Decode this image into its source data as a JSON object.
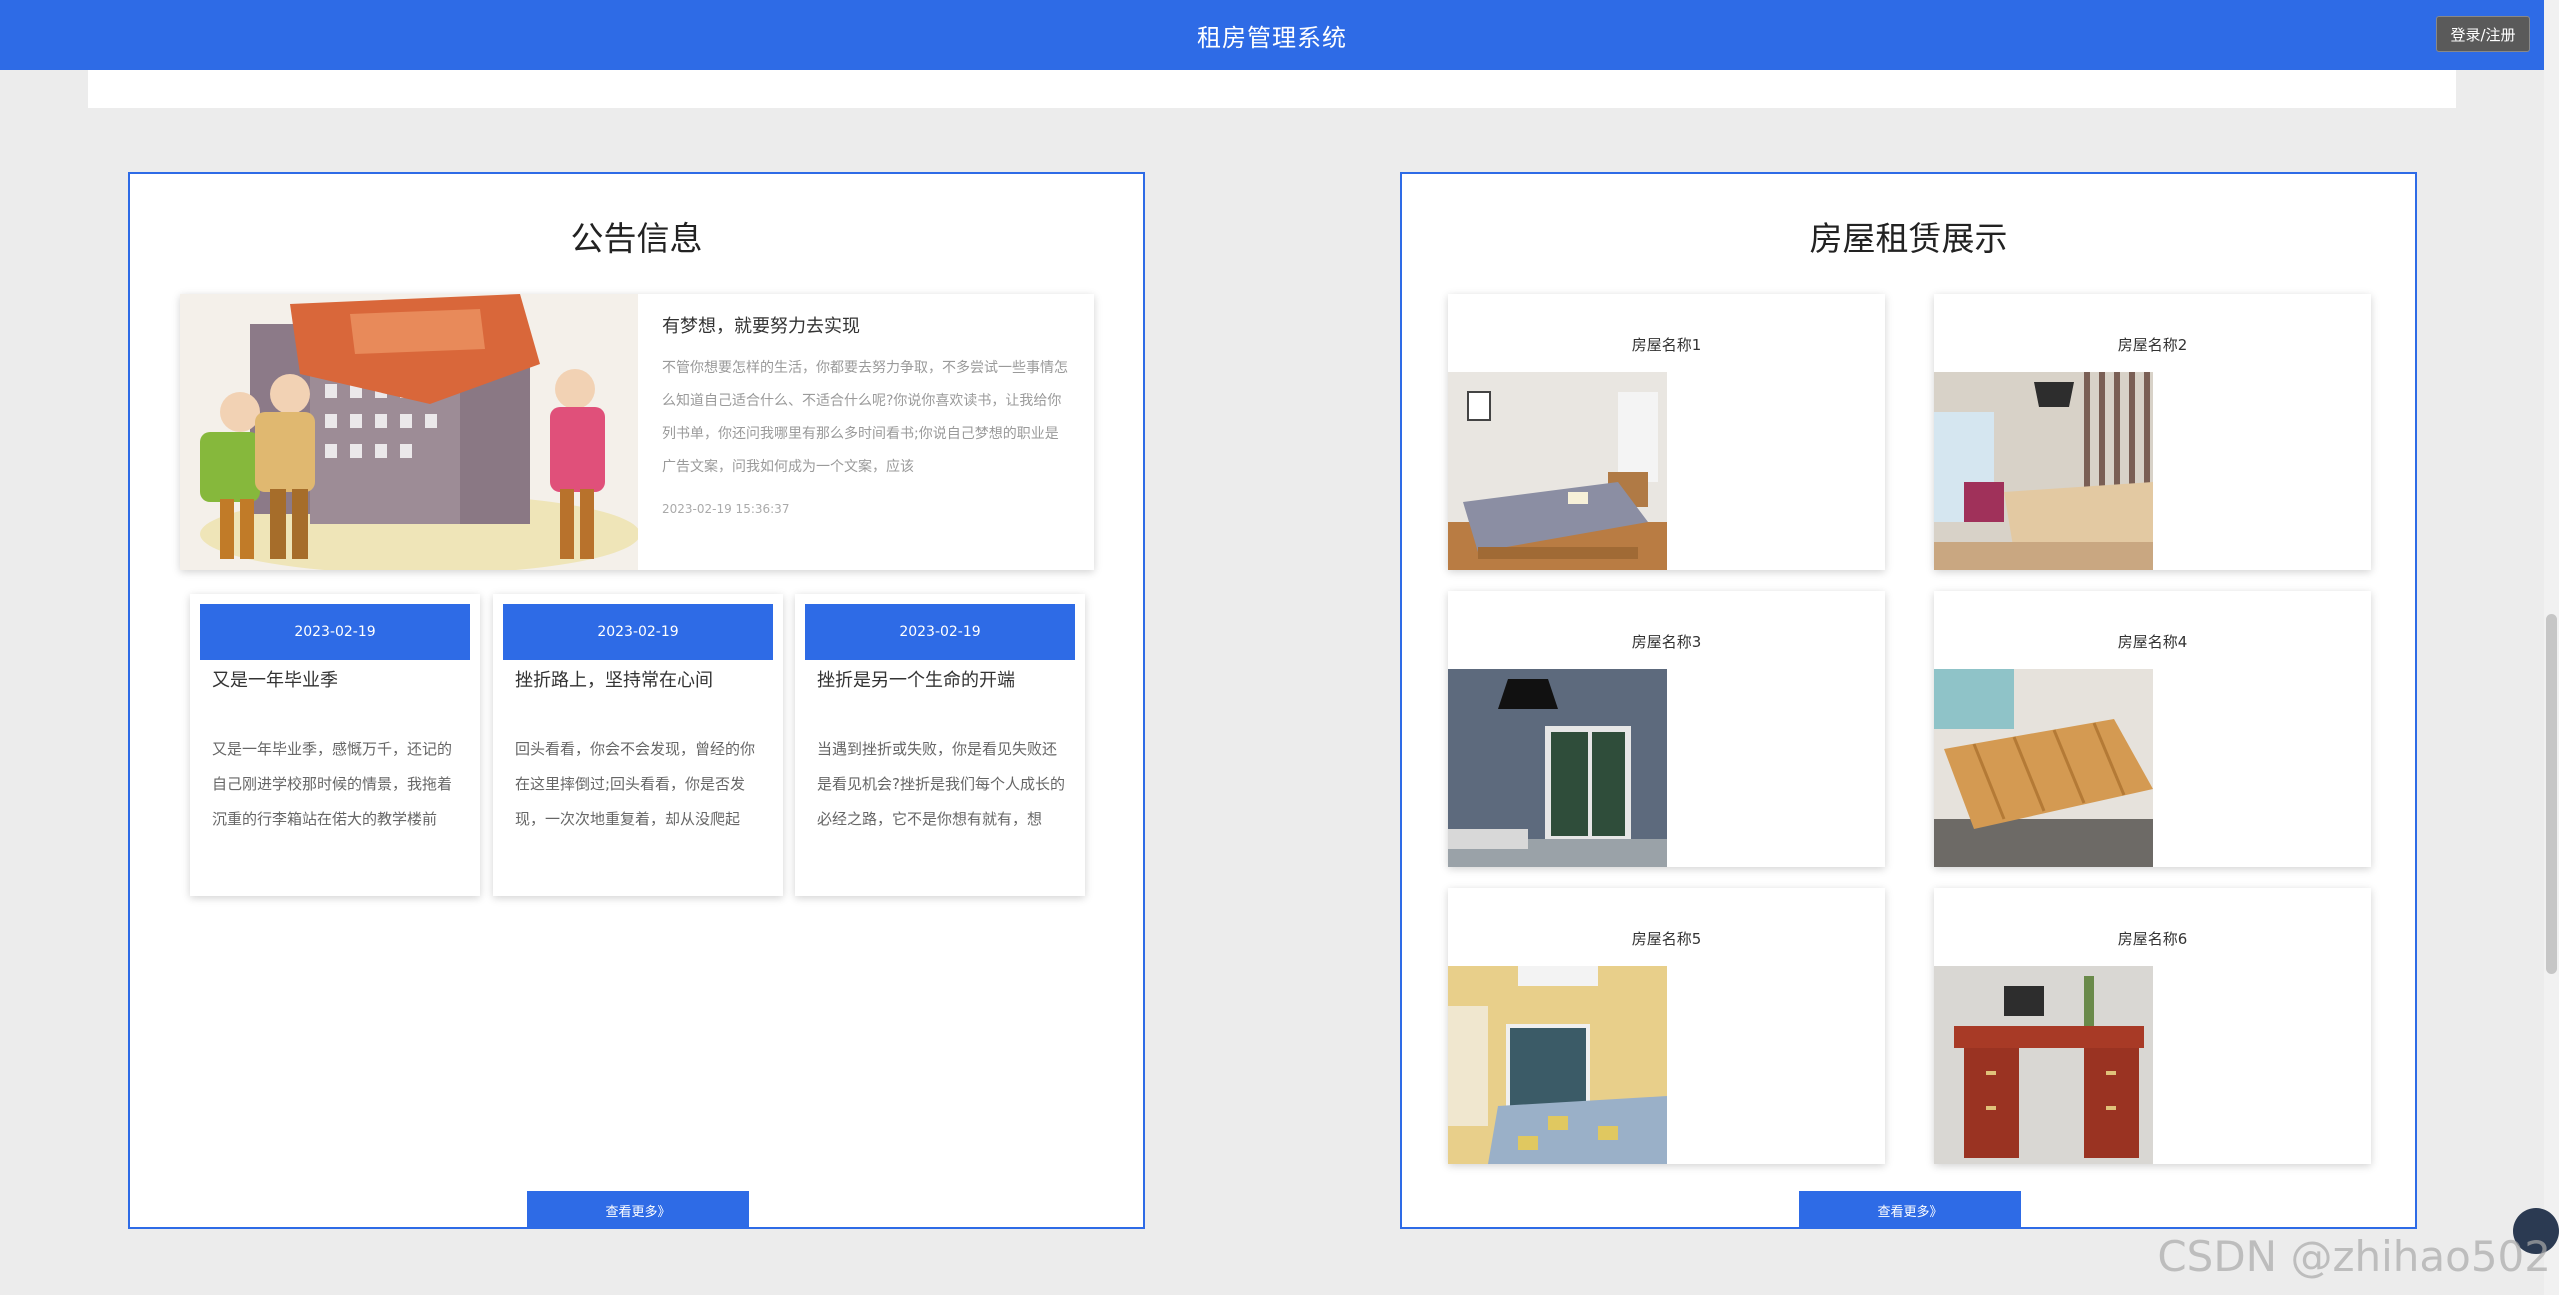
{
  "header": {
    "title": "租房管理系统",
    "login_label": "登录/注册"
  },
  "notices": {
    "title": "公告信息",
    "featured": {
      "title": "有梦想，就要努力去实现",
      "desc": "不管你想要怎样的生活，你都要去努力争取，不多尝试一些事情怎么知道自己适合什么、不适合什么呢?你说你喜欢读书，让我给你列书单，你还问我哪里有那么多时间看书;你说自己梦想的职业是广告文案，问我如何成为一个文案，应该",
      "date": "2023-02-19 15:36:37"
    },
    "cards": [
      {
        "date": "2023-02-19",
        "title": "又是一年毕业季",
        "desc": "又是一年毕业季，感慨万千，还记的自己刚进学校那时候的情景，我拖着沉重的行李箱站在偌大的教学楼前"
      },
      {
        "date": "2023-02-19",
        "title": "挫折路上，坚持常在心间",
        "desc": "回头看看，你会不会发现，曾经的你在这里摔倒过;回头看看，你是否发现，一次次地重复着，却从没爬起"
      },
      {
        "date": "2023-02-19",
        "title": "挫折是另一个生命的开端",
        "desc": "当遇到挫折或失败，你是看见失败还是看见机会?挫折是我们每个人成长的必经之路，它不是你想有就有，想"
      }
    ],
    "more_label": "查看更多》"
  },
  "houses": {
    "title": "房屋租赁展示",
    "items": [
      {
        "name": "房屋名称1"
      },
      {
        "name": "房屋名称2"
      },
      {
        "name": "房屋名称3"
      },
      {
        "name": "房屋名称4"
      },
      {
        "name": "房屋名称5"
      },
      {
        "name": "房屋名称6"
      }
    ],
    "more_label": "查看更多》"
  },
  "watermark": "CSDN @zhihao502",
  "colors": {
    "primary": "#2e6be6",
    "background": "#ececec"
  }
}
